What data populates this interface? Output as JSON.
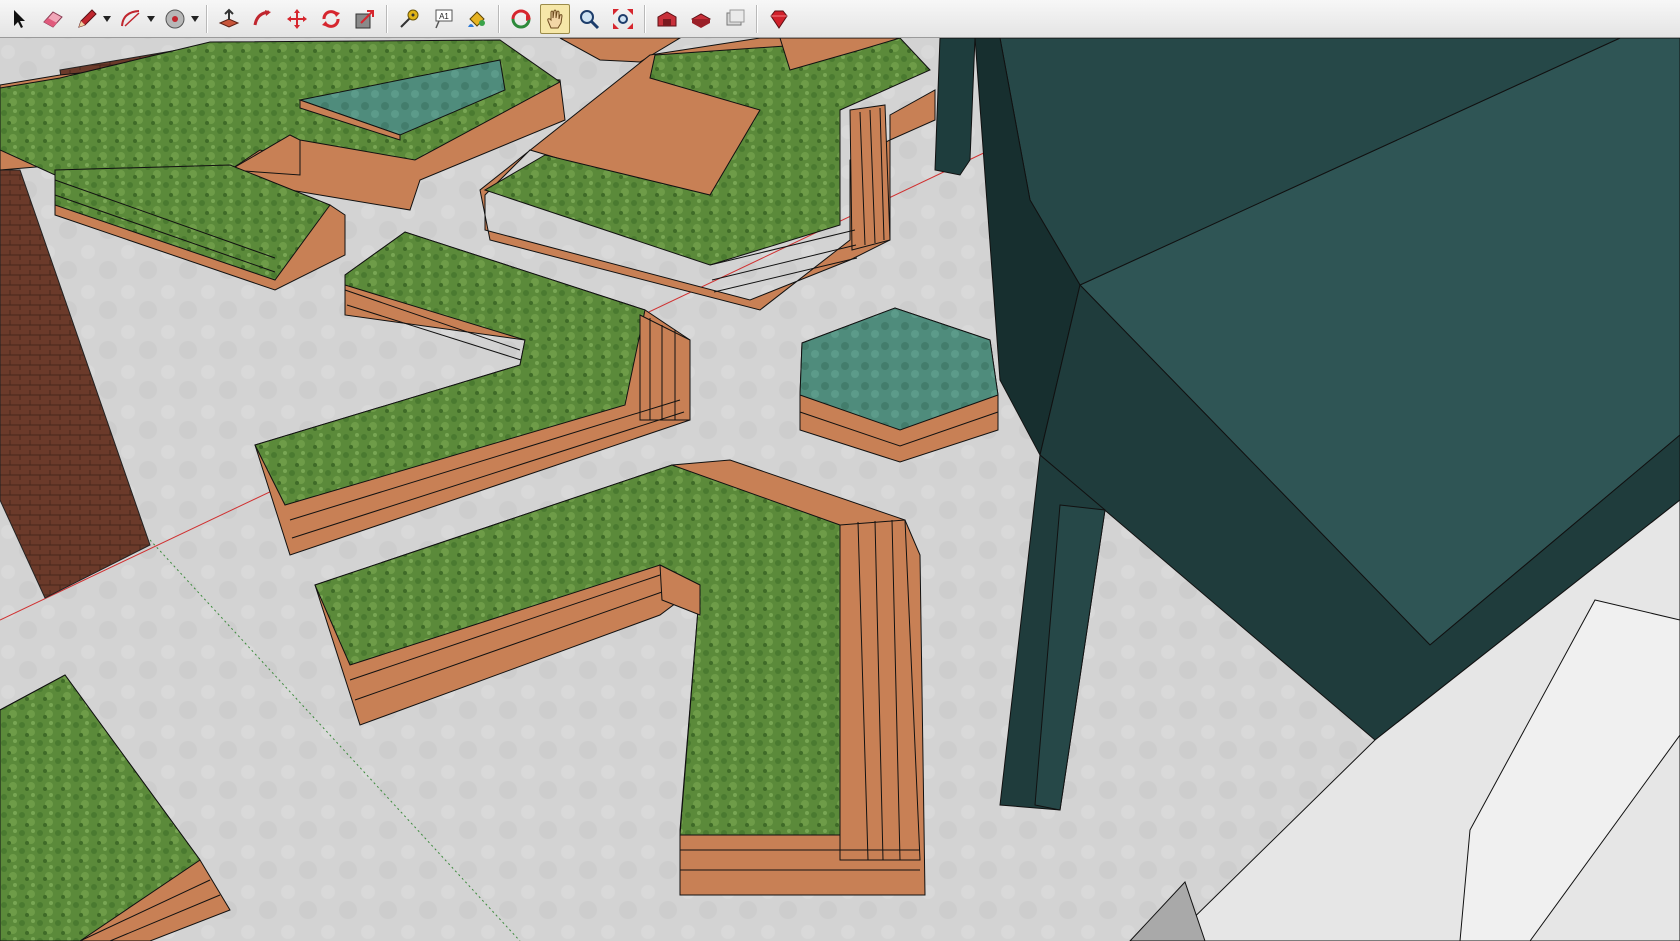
{
  "app": {
    "toolbar": {
      "tools": [
        {
          "name": "select",
          "icon": "arrow-pointer-icon"
        },
        {
          "name": "eraser",
          "icon": "eraser-icon"
        },
        {
          "name": "pencil",
          "icon": "pencil-icon",
          "dropdown": true
        },
        {
          "name": "arc",
          "icon": "arc-icon",
          "dropdown": true
        },
        {
          "name": "circle",
          "icon": "circle-icon",
          "dropdown": true
        },
        {
          "name": "push-pull",
          "icon": "push-pull-icon"
        },
        {
          "name": "follow-me",
          "icon": "follow-me-icon"
        },
        {
          "name": "move",
          "icon": "move-icon"
        },
        {
          "name": "rotate",
          "icon": "rotate-icon"
        },
        {
          "name": "scale",
          "icon": "scale-icon"
        },
        {
          "name": "tape-measure",
          "icon": "tape-measure-icon"
        },
        {
          "name": "text",
          "icon": "text-icon",
          "label": "A1"
        },
        {
          "name": "paint-bucket",
          "icon": "paint-bucket-icon"
        },
        {
          "name": "orbit",
          "icon": "orbit-icon"
        },
        {
          "name": "pan",
          "icon": "hand-icon",
          "active": true
        },
        {
          "name": "zoom",
          "icon": "magnifier-icon"
        },
        {
          "name": "zoom-extents",
          "icon": "zoom-extents-icon"
        },
        {
          "name": "3d-warehouse",
          "icon": "warehouse-icon"
        },
        {
          "name": "share-model",
          "icon": "share-model-icon"
        },
        {
          "name": "get-models",
          "icon": "get-models-icon"
        },
        {
          "name": "extension-warehouse",
          "icon": "ruby-icon"
        }
      ]
    },
    "colors": {
      "ground": "#d3d3d3",
      "grass": "#5b8a3a",
      "water": "#4f8c7c",
      "wood": "#c88055",
      "brick": "#6b3a2a",
      "building": "#244545",
      "building_light": "#2f5555",
      "wall_white": "#e6e6e6",
      "axis_red": "#d03030",
      "axis_green": "#3c8a3c",
      "active_tool_bg": "#f6e7a8"
    }
  }
}
